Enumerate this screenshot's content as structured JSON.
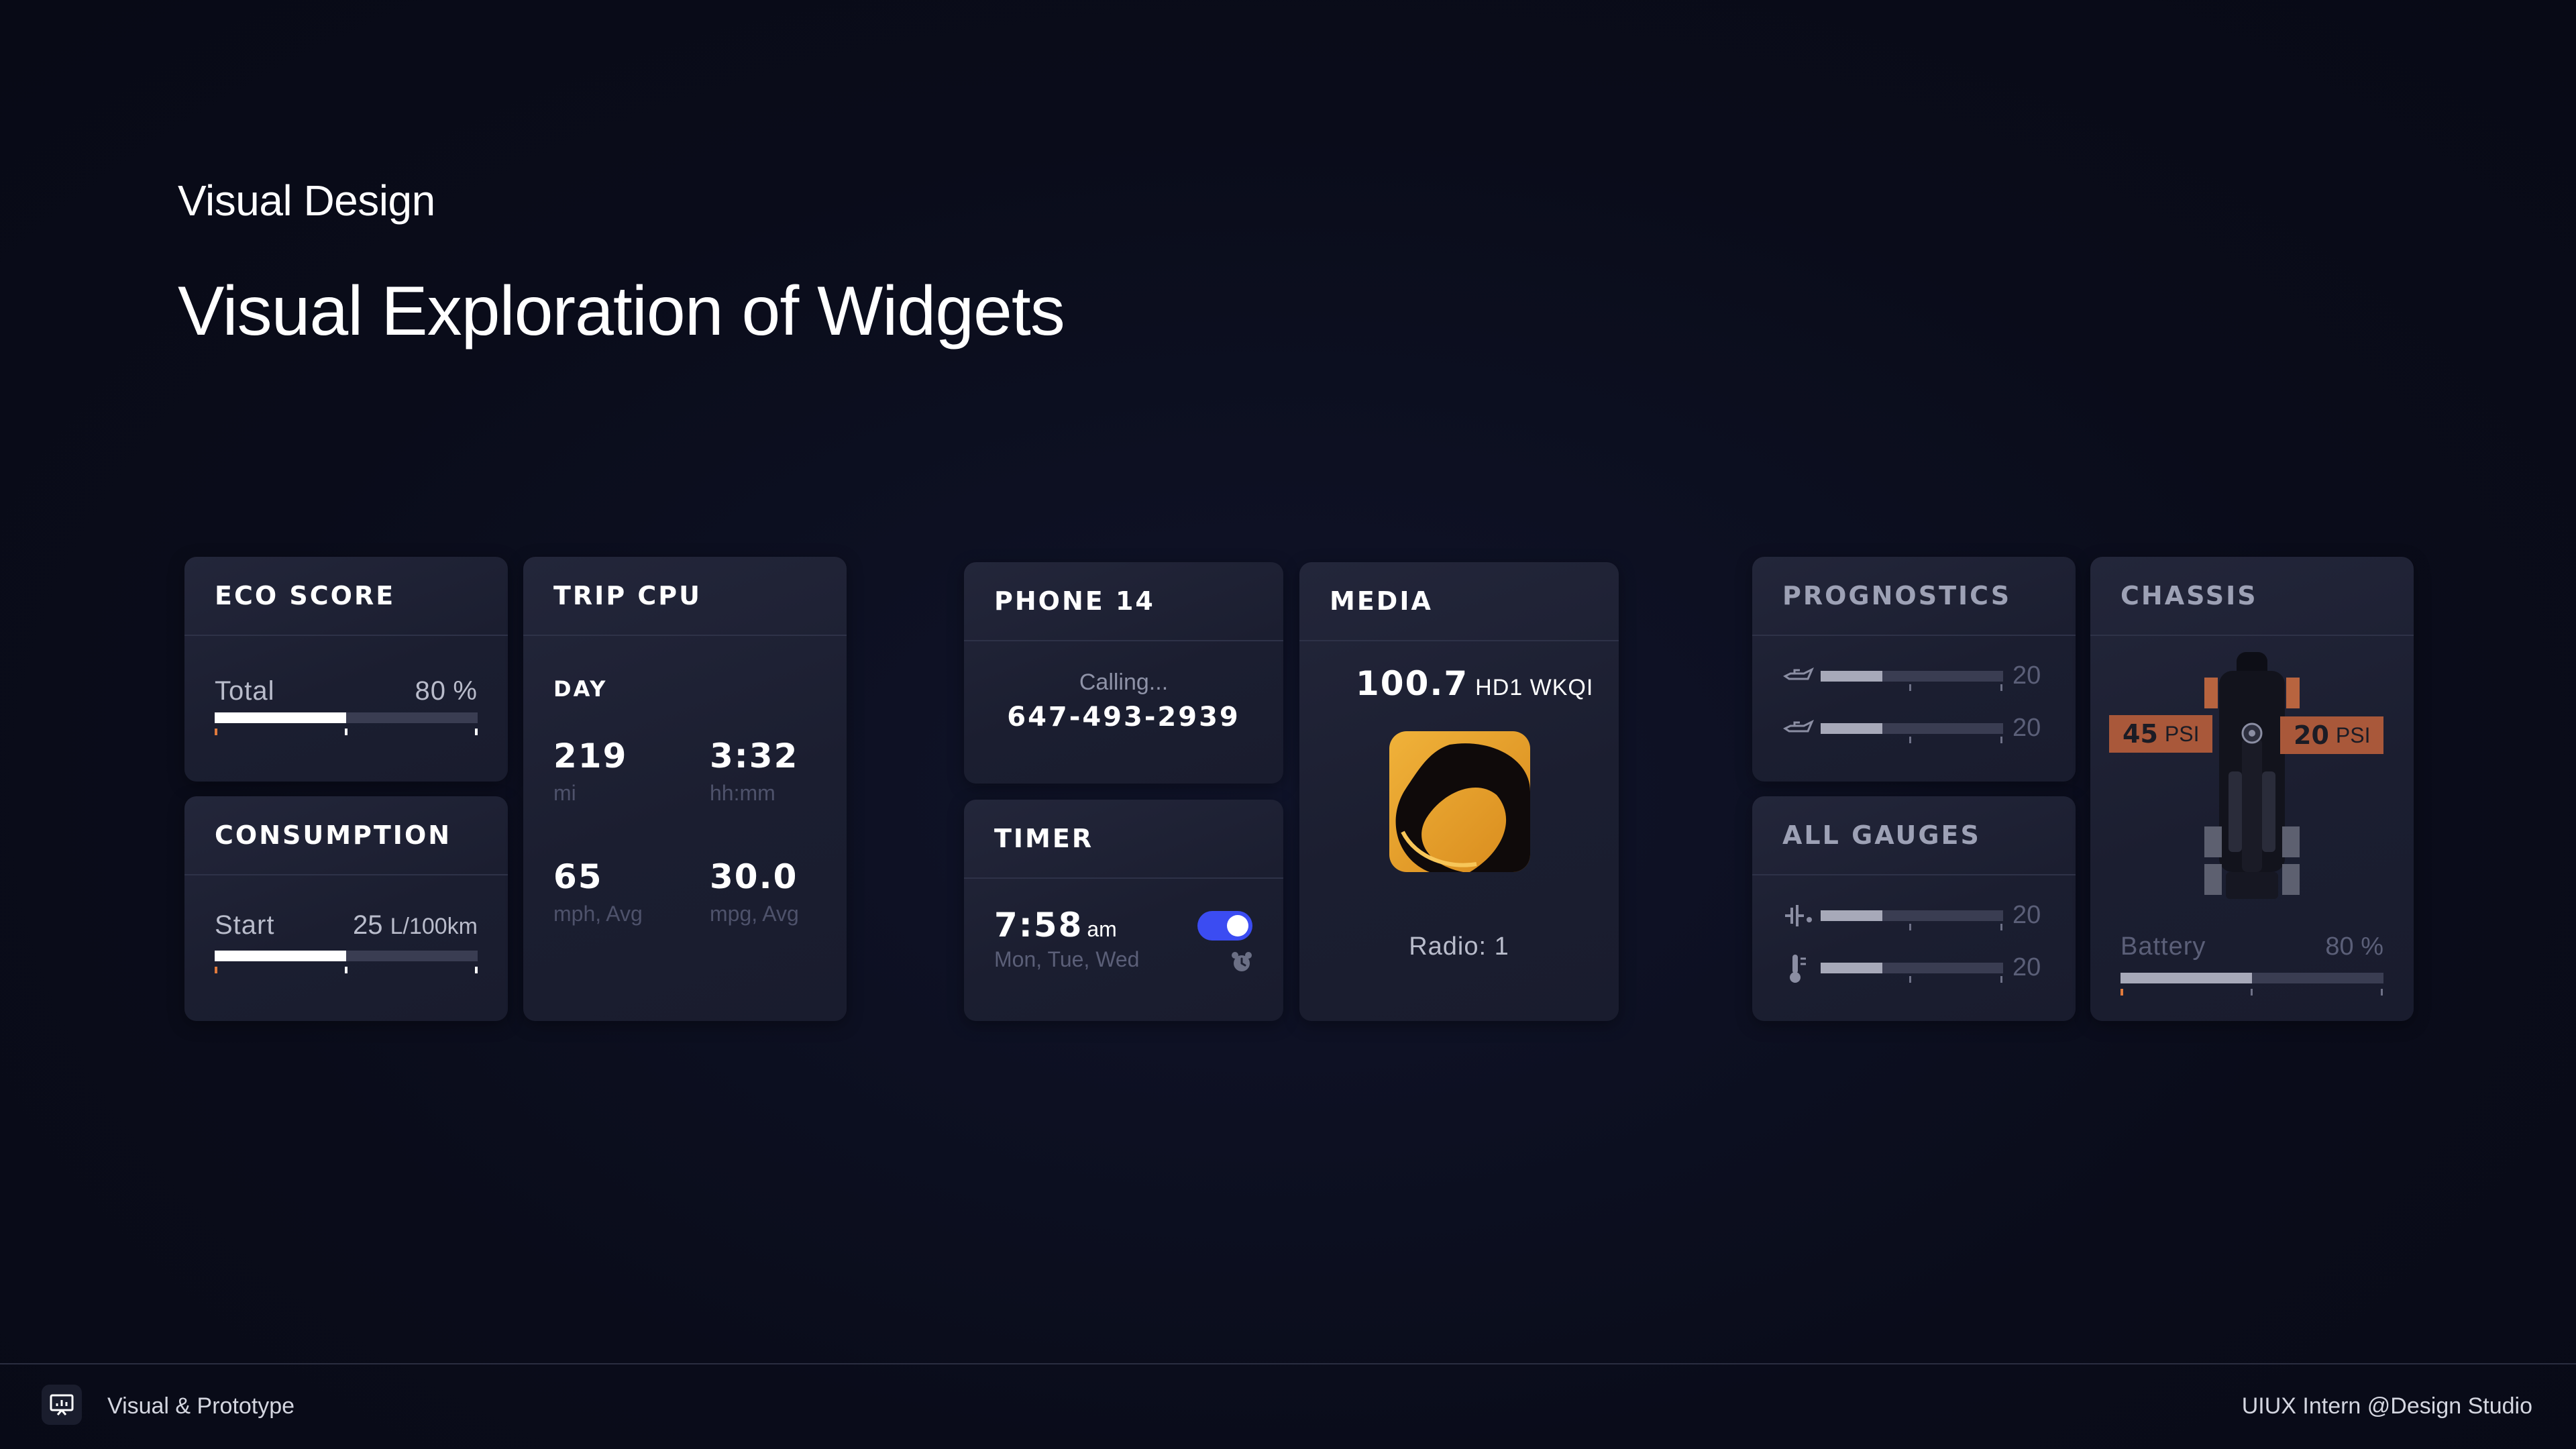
{
  "header": {
    "subtitle": "Visual Design",
    "title": "Visual Exploration of Widgets"
  },
  "eco_score": {
    "title": "ECO SCORE",
    "label": "Total",
    "value": "80",
    "unit": "%",
    "fill_percent": 50
  },
  "consumption": {
    "title": "CONSUMPTION",
    "label": "Start",
    "value": "25",
    "unit": "L/100km",
    "fill_percent": 50
  },
  "trip_cpu": {
    "title": "TRIP CPU",
    "period": "DAY",
    "stats": [
      {
        "value": "219",
        "unit": "mi"
      },
      {
        "value": "3:32",
        "unit": "hh:mm"
      },
      {
        "value": "65",
        "unit": "mph, Avg"
      },
      {
        "value": "30.0",
        "unit": "mpg, Avg"
      }
    ]
  },
  "phone": {
    "title": "PHONE 14",
    "status": "Calling...",
    "number": "647-493-2939"
  },
  "timer": {
    "title": "TIMER",
    "time": "7:58",
    "ampm": "am",
    "days": "Mon, Tue, Wed",
    "toggle_on": true
  },
  "media": {
    "title": "MEDIA",
    "frequency": "100.7",
    "station": "HD1 WKQI",
    "source": "Radio: 1"
  },
  "prognostics": {
    "title": "PROGNOSTICS",
    "rows": [
      {
        "icon": "oil-can-icon",
        "value": "20",
        "fill_percent": 34
      },
      {
        "icon": "oil-can-icon",
        "value": "20",
        "fill_percent": 34
      }
    ]
  },
  "all_gauges": {
    "title": "ALL GAUGES",
    "rows": [
      {
        "icon": "battery-level-icon",
        "value": "20",
        "fill_percent": 34
      },
      {
        "icon": "thermometer-icon",
        "value": "20",
        "fill_percent": 34
      }
    ]
  },
  "chassis": {
    "title": "CHASSIS",
    "left_psi": "45",
    "right_psi": "20",
    "psi_unit": "PSI",
    "battery_label": "Battery",
    "battery_value": "80",
    "battery_unit": "%",
    "battery_fill_percent": 50
  },
  "footer": {
    "left_label": "Visual & Prototype",
    "right_label": "UIUX Intern @Design Studio"
  },
  "colors": {
    "background": "#0a0c1a",
    "card": "#1e2133",
    "accent_blue": "#3b4cf2",
    "psi_badge": "#a9583a",
    "tick_orange": "#e07a3c"
  }
}
